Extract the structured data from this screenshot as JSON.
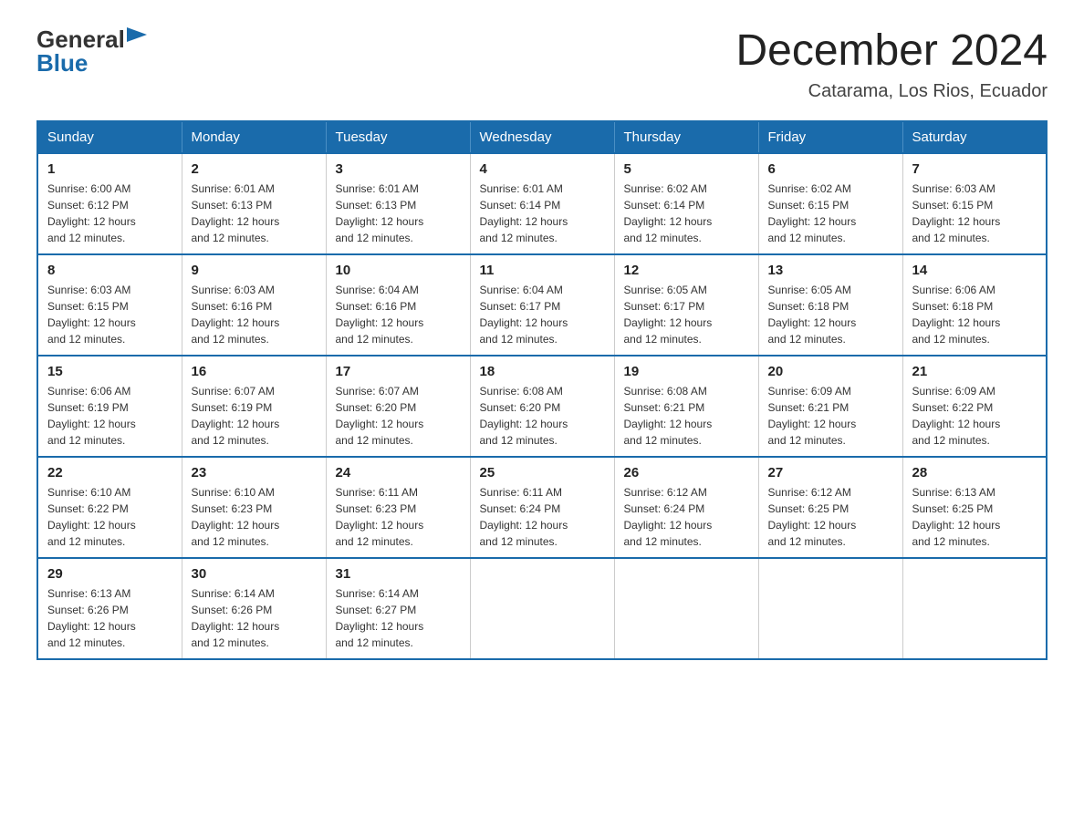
{
  "logo": {
    "general": "General",
    "blue": "Blue",
    "triangle": "▶"
  },
  "title": "December 2024",
  "subtitle": "Catarama, Los Rios, Ecuador",
  "days_of_week": [
    "Sunday",
    "Monday",
    "Tuesday",
    "Wednesday",
    "Thursday",
    "Friday",
    "Saturday"
  ],
  "weeks": [
    [
      {
        "day": "1",
        "sunrise": "6:00 AM",
        "sunset": "6:12 PM",
        "daylight": "12 hours and 12 minutes."
      },
      {
        "day": "2",
        "sunrise": "6:01 AM",
        "sunset": "6:13 PM",
        "daylight": "12 hours and 12 minutes."
      },
      {
        "day": "3",
        "sunrise": "6:01 AM",
        "sunset": "6:13 PM",
        "daylight": "12 hours and 12 minutes."
      },
      {
        "day": "4",
        "sunrise": "6:01 AM",
        "sunset": "6:14 PM",
        "daylight": "12 hours and 12 minutes."
      },
      {
        "day": "5",
        "sunrise": "6:02 AM",
        "sunset": "6:14 PM",
        "daylight": "12 hours and 12 minutes."
      },
      {
        "day": "6",
        "sunrise": "6:02 AM",
        "sunset": "6:15 PM",
        "daylight": "12 hours and 12 minutes."
      },
      {
        "day": "7",
        "sunrise": "6:03 AM",
        "sunset": "6:15 PM",
        "daylight": "12 hours and 12 minutes."
      }
    ],
    [
      {
        "day": "8",
        "sunrise": "6:03 AM",
        "sunset": "6:15 PM",
        "daylight": "12 hours and 12 minutes."
      },
      {
        "day": "9",
        "sunrise": "6:03 AM",
        "sunset": "6:16 PM",
        "daylight": "12 hours and 12 minutes."
      },
      {
        "day": "10",
        "sunrise": "6:04 AM",
        "sunset": "6:16 PM",
        "daylight": "12 hours and 12 minutes."
      },
      {
        "day": "11",
        "sunrise": "6:04 AM",
        "sunset": "6:17 PM",
        "daylight": "12 hours and 12 minutes."
      },
      {
        "day": "12",
        "sunrise": "6:05 AM",
        "sunset": "6:17 PM",
        "daylight": "12 hours and 12 minutes."
      },
      {
        "day": "13",
        "sunrise": "6:05 AM",
        "sunset": "6:18 PM",
        "daylight": "12 hours and 12 minutes."
      },
      {
        "day": "14",
        "sunrise": "6:06 AM",
        "sunset": "6:18 PM",
        "daylight": "12 hours and 12 minutes."
      }
    ],
    [
      {
        "day": "15",
        "sunrise": "6:06 AM",
        "sunset": "6:19 PM",
        "daylight": "12 hours and 12 minutes."
      },
      {
        "day": "16",
        "sunrise": "6:07 AM",
        "sunset": "6:19 PM",
        "daylight": "12 hours and 12 minutes."
      },
      {
        "day": "17",
        "sunrise": "6:07 AM",
        "sunset": "6:20 PM",
        "daylight": "12 hours and 12 minutes."
      },
      {
        "day": "18",
        "sunrise": "6:08 AM",
        "sunset": "6:20 PM",
        "daylight": "12 hours and 12 minutes."
      },
      {
        "day": "19",
        "sunrise": "6:08 AM",
        "sunset": "6:21 PM",
        "daylight": "12 hours and 12 minutes."
      },
      {
        "day": "20",
        "sunrise": "6:09 AM",
        "sunset": "6:21 PM",
        "daylight": "12 hours and 12 minutes."
      },
      {
        "day": "21",
        "sunrise": "6:09 AM",
        "sunset": "6:22 PM",
        "daylight": "12 hours and 12 minutes."
      }
    ],
    [
      {
        "day": "22",
        "sunrise": "6:10 AM",
        "sunset": "6:22 PM",
        "daylight": "12 hours and 12 minutes."
      },
      {
        "day": "23",
        "sunrise": "6:10 AM",
        "sunset": "6:23 PM",
        "daylight": "12 hours and 12 minutes."
      },
      {
        "day": "24",
        "sunrise": "6:11 AM",
        "sunset": "6:23 PM",
        "daylight": "12 hours and 12 minutes."
      },
      {
        "day": "25",
        "sunrise": "6:11 AM",
        "sunset": "6:24 PM",
        "daylight": "12 hours and 12 minutes."
      },
      {
        "day": "26",
        "sunrise": "6:12 AM",
        "sunset": "6:24 PM",
        "daylight": "12 hours and 12 minutes."
      },
      {
        "day": "27",
        "sunrise": "6:12 AM",
        "sunset": "6:25 PM",
        "daylight": "12 hours and 12 minutes."
      },
      {
        "day": "28",
        "sunrise": "6:13 AM",
        "sunset": "6:25 PM",
        "daylight": "12 hours and 12 minutes."
      }
    ],
    [
      {
        "day": "29",
        "sunrise": "6:13 AM",
        "sunset": "6:26 PM",
        "daylight": "12 hours and 12 minutes."
      },
      {
        "day": "30",
        "sunrise": "6:14 AM",
        "sunset": "6:26 PM",
        "daylight": "12 hours and 12 minutes."
      },
      {
        "day": "31",
        "sunrise": "6:14 AM",
        "sunset": "6:27 PM",
        "daylight": "12 hours and 12 minutes."
      },
      null,
      null,
      null,
      null
    ]
  ],
  "labels": {
    "sunrise": "Sunrise:",
    "sunset": "Sunset:",
    "daylight": "Daylight:"
  }
}
